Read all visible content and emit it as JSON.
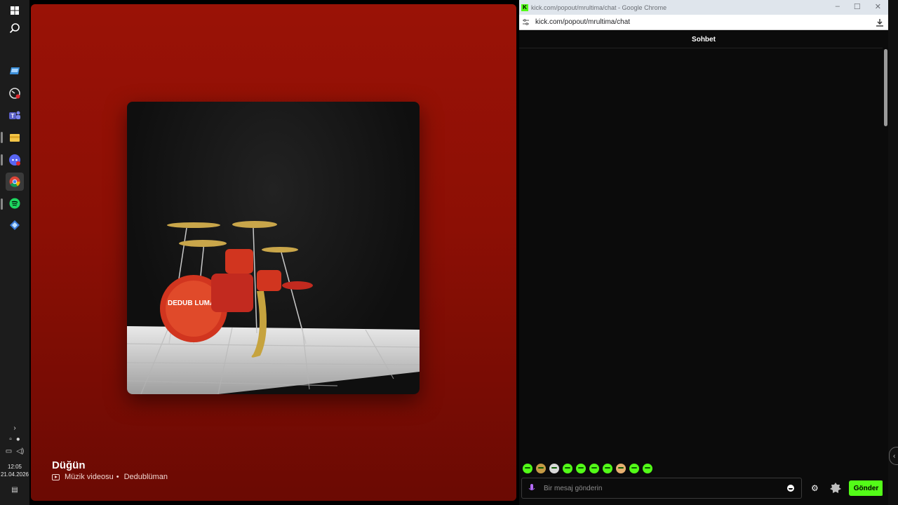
{
  "taskbar": {
    "icons": [
      "windows-start-icon",
      "search-icon",
      "sandbox-app-icon",
      "speedometer-app-icon",
      "teams-app-icon",
      "file-explorer-icon",
      "discord-icon",
      "chrome-icon",
      "spotify-icon",
      "app-icon"
    ],
    "time": "12:05",
    "date": "21.04.2026"
  },
  "spotify": {
    "title": "Düğün",
    "type_label": "Müzik videosu",
    "separator": "•",
    "artist": "Dedublüman",
    "cover_text": "DEDUB LUMAN",
    "background_color": "#9a1206"
  },
  "chrome": {
    "window_title": "kick.com/popout/mrultima/chat - Google Chrome",
    "url": "kick.com/popout/mrultima/chat"
  },
  "chat": {
    "header": "Sohbet",
    "input_placeholder": "Bir mesaj gönderin",
    "send_label": "Gönder",
    "accent_color": "#53fc18"
  }
}
